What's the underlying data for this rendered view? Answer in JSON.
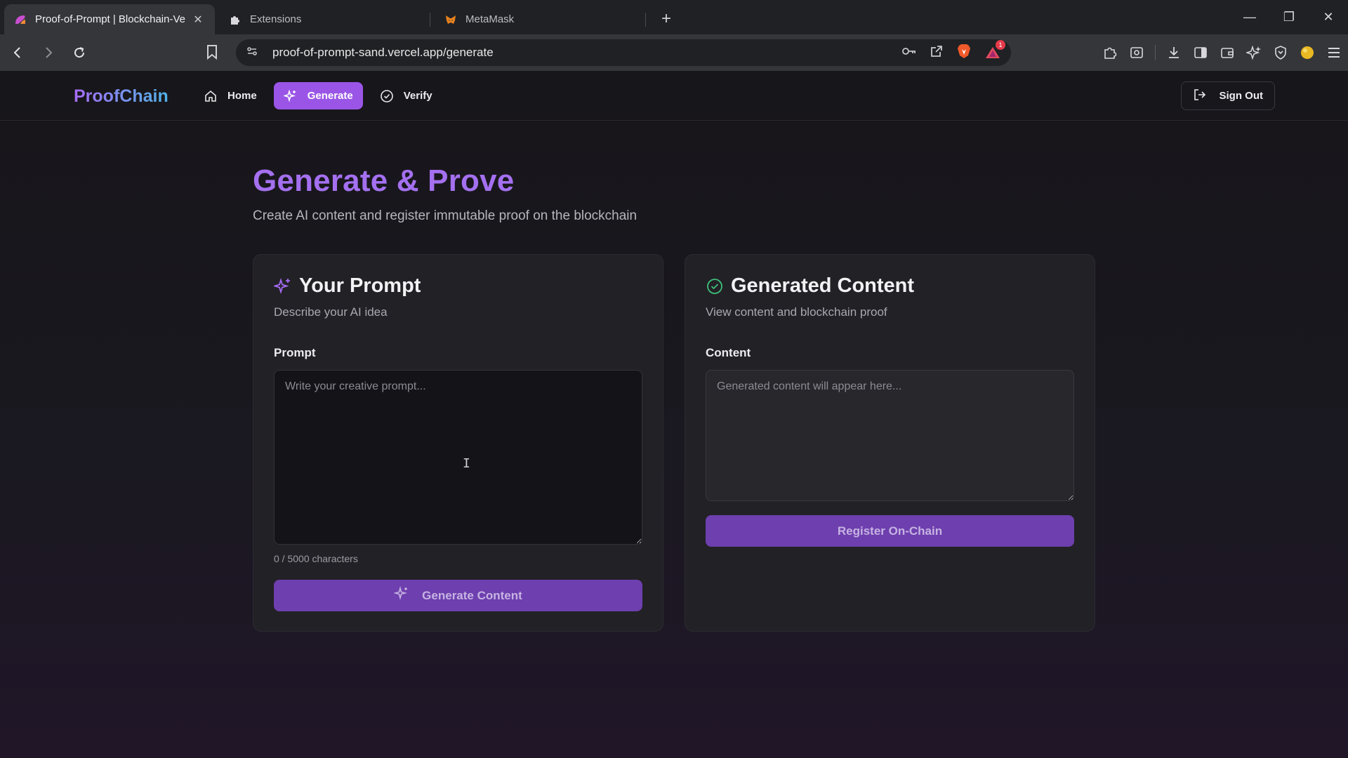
{
  "browser": {
    "tabs": [
      {
        "title": "Proof-of-Prompt | Blockchain-Ve",
        "active": true,
        "icon": "app-favicon"
      },
      {
        "title": "Extensions",
        "active": false,
        "icon": "puzzle-icon"
      },
      {
        "title": "MetaMask",
        "active": false,
        "icon": "metamask-fox-icon"
      }
    ],
    "url": "proof-of-prompt-sand.vercel.app/generate",
    "brave_badge_count": "1"
  },
  "app": {
    "brand": "ProofChain",
    "nav": {
      "home": "Home",
      "generate": "Generate",
      "verify": "Verify",
      "sign_out": "Sign Out"
    },
    "hero": {
      "title": "Generate & Prove",
      "subtitle": "Create AI content and register immutable proof on the blockchain"
    },
    "prompt_card": {
      "title": "Your Prompt",
      "subtitle": "Describe your AI idea",
      "field_label": "Prompt",
      "placeholder": "Write your creative prompt...",
      "value": "",
      "counter": "0 / 5000 characters",
      "button": "Generate Content"
    },
    "content_card": {
      "title": "Generated Content",
      "subtitle": "View content and blockchain proof",
      "field_label": "Content",
      "placeholder": "Generated content will appear here...",
      "button": "Register On-Chain"
    }
  },
  "colors": {
    "accent": "#9a55e6",
    "title_purple": "#a470f0",
    "button_disabled": "#6e3fae",
    "success_green": "#3fbf7a"
  }
}
